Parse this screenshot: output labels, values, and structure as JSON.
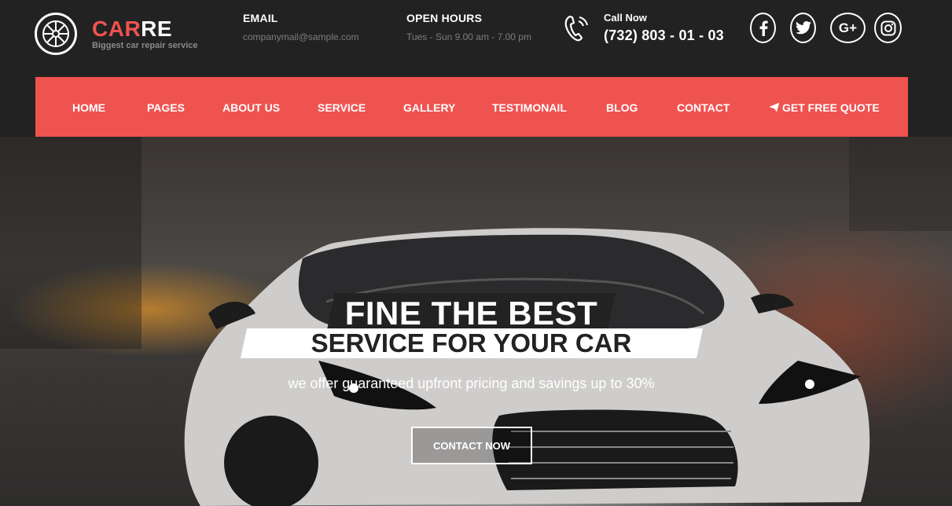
{
  "brand": {
    "name_part1": "CAR",
    "name_part2": "RE",
    "tagline": "Biggest car repair service",
    "accent": "#ef5350"
  },
  "header": {
    "email": {
      "label": "EMAIL",
      "value": "companymail@sample.com"
    },
    "hours": {
      "label": "OPEN HOURS",
      "value": "Tues - Sun 9.00 am - 7.00 pm"
    },
    "call": {
      "label": "Call Now",
      "value": "(732) 803 - 01 - 03",
      "icon": "phone-ringing-icon"
    },
    "socials": [
      {
        "name": "facebook",
        "glyph": "f"
      },
      {
        "name": "twitter",
        "glyph": "t"
      },
      {
        "name": "google-plus",
        "glyph": "G+"
      },
      {
        "name": "instagram",
        "glyph": "ig"
      }
    ]
  },
  "nav": {
    "items": [
      "HOME",
      "PAGES",
      "ABOUT US",
      "SERVICE",
      "GALLERY",
      "TESTIMONAIL",
      "BLOG",
      "CONTACT"
    ],
    "quote_label": "GET FREE QUOTE",
    "quote_icon": "paper-plane-icon",
    "bg": "#ef5350"
  },
  "hero": {
    "title_line1": "FINE THE BEST",
    "title_line2": "SERVICE FOR YOUR CAR",
    "subtitle": "we offer guaranteed upfront pricing and savings up to 30%",
    "cta_label": "CONTACT NOW"
  }
}
